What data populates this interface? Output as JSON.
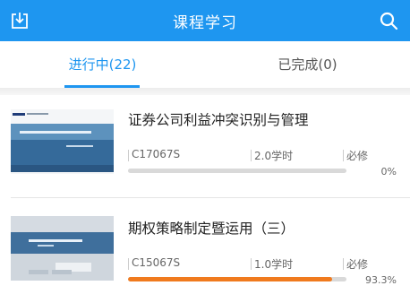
{
  "header": {
    "title": "课程学习"
  },
  "tabs": [
    {
      "label": "进行中(22)",
      "active": true
    },
    {
      "label": "已完成(0)",
      "active": false
    }
  ],
  "courses": [
    {
      "title": "证券公司利益冲突识别与管理",
      "code": "C17067S",
      "hours": "2.0学时",
      "type": "必修",
      "progress_label": "0%",
      "progress": 0
    },
    {
      "title": "期权策略制定暨运用（三）",
      "code": "C15067S",
      "hours": "1.0学时",
      "type": "必修",
      "progress_label": "93.3%",
      "progress": 0.933
    }
  ],
  "colors": {
    "accent": "#1e96f0",
    "progress": "#f07a1e"
  },
  "icons": {
    "header_left": "download-icon",
    "header_right": "search-icon"
  }
}
